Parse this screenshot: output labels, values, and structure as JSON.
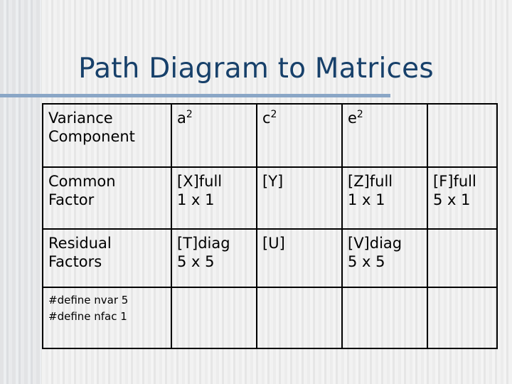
{
  "slide": {
    "title": "Path Diagram to Matrices",
    "accent_color": "#8aa6c6",
    "title_color": "#17406a",
    "background_color": "#f1f1f1"
  },
  "table": {
    "header": {
      "label": "Variance Component",
      "label_line1": "Variance",
      "label_line2": "Component",
      "col_a_base": "a",
      "col_a_sup": "2",
      "col_c_base": "c",
      "col_c_sup": "2",
      "col_e_base": "e",
      "col_e_sup": "2",
      "col_extra": ""
    },
    "rows": [
      {
        "label_line1": "Common",
        "label_line2": "Factor",
        "a_line1": "[X]full",
        "a_line2": "1 x 1",
        "c_line1": "[Y]",
        "c_line2": "",
        "e_line1": "[Z]full",
        "e_line2": "1 x 1",
        "extra_line1": "[F]full",
        "extra_line2": "5 x 1"
      },
      {
        "label_line1": "Residual",
        "label_line2": "Factors",
        "a_line1": "[T]diag",
        "a_line2": "5 x 5",
        "c_line1": "[U]",
        "c_line2": "",
        "e_line1": "[V]diag",
        "e_line2": "5 x 5",
        "extra_line1": "",
        "extra_line2": ""
      },
      {
        "label_line1": "#define nvar 5",
        "label_line2": "#define nfac 1",
        "a_line1": "",
        "a_line2": "",
        "c_line1": "",
        "c_line2": "",
        "e_line1": "",
        "e_line2": "",
        "extra_line1": "",
        "extra_line2": ""
      }
    ]
  }
}
